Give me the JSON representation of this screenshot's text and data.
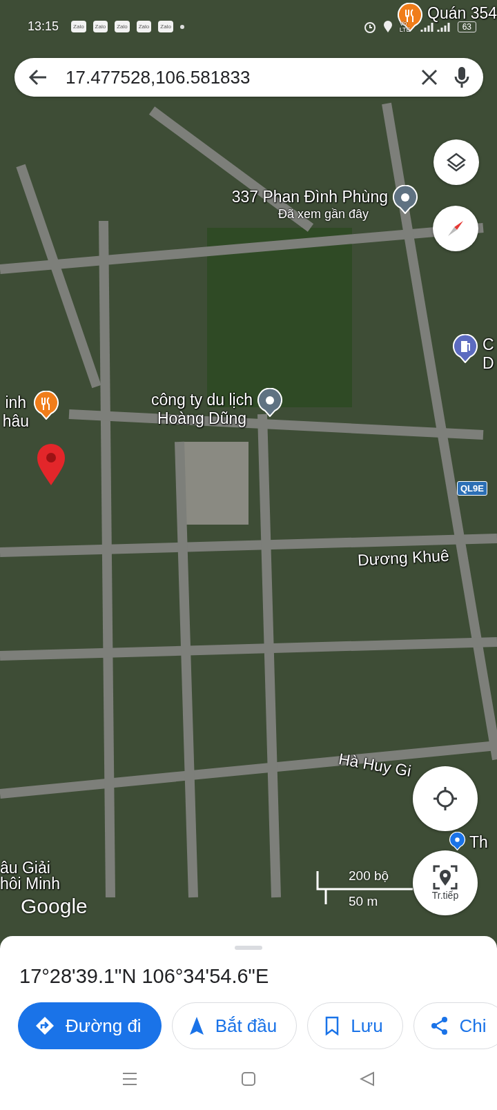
{
  "status_bar": {
    "time": "13:15",
    "notifications": [
      "Zalo",
      "Zalo",
      "Zalo",
      "Zalo",
      "Zalo"
    ],
    "network": "Vo LTE",
    "battery": "63"
  },
  "search_bar": {
    "value": "17.477528,106.581833"
  },
  "map": {
    "places": [
      {
        "kind": "restaurant",
        "lines": [
          "Quán 354"
        ]
      },
      {
        "kind": "visited",
        "lines": [
          "337 Phan Đình Phùng"
        ],
        "note": "Đã xem gần đây"
      },
      {
        "kind": "restaurant",
        "lines": [
          "inh",
          "hâu"
        ]
      },
      {
        "kind": "visited",
        "lines": [
          "công ty du lịch",
          "Hoàng Dũng"
        ]
      },
      {
        "kind": "gas",
        "lines": [
          "C",
          "D"
        ]
      },
      {
        "kind": "business",
        "lines": [
          "Th"
        ]
      },
      {
        "kind": "text",
        "lines": [
          "âu Giải",
          "hôi Minh"
        ]
      }
    ],
    "roads": [
      "Dương Khuê",
      "Hà Huy Gi"
    ],
    "route_badge": "QL9E",
    "scale": {
      "imperial": "200 bộ",
      "metric": "50 m"
    },
    "attribution": "Google",
    "live_view_label": "Tr.tiếp"
  },
  "sheet": {
    "coordinates": "17°28'39.1\"N 106°34'54.6\"E",
    "actions": [
      {
        "kind": "directions",
        "label": "Đường đi",
        "primary": true
      },
      {
        "kind": "start",
        "label": "Bắt đầu",
        "primary": false
      },
      {
        "kind": "save",
        "label": "Lưu",
        "primary": false
      },
      {
        "kind": "share",
        "label": "Chi",
        "primary": false
      }
    ]
  }
}
